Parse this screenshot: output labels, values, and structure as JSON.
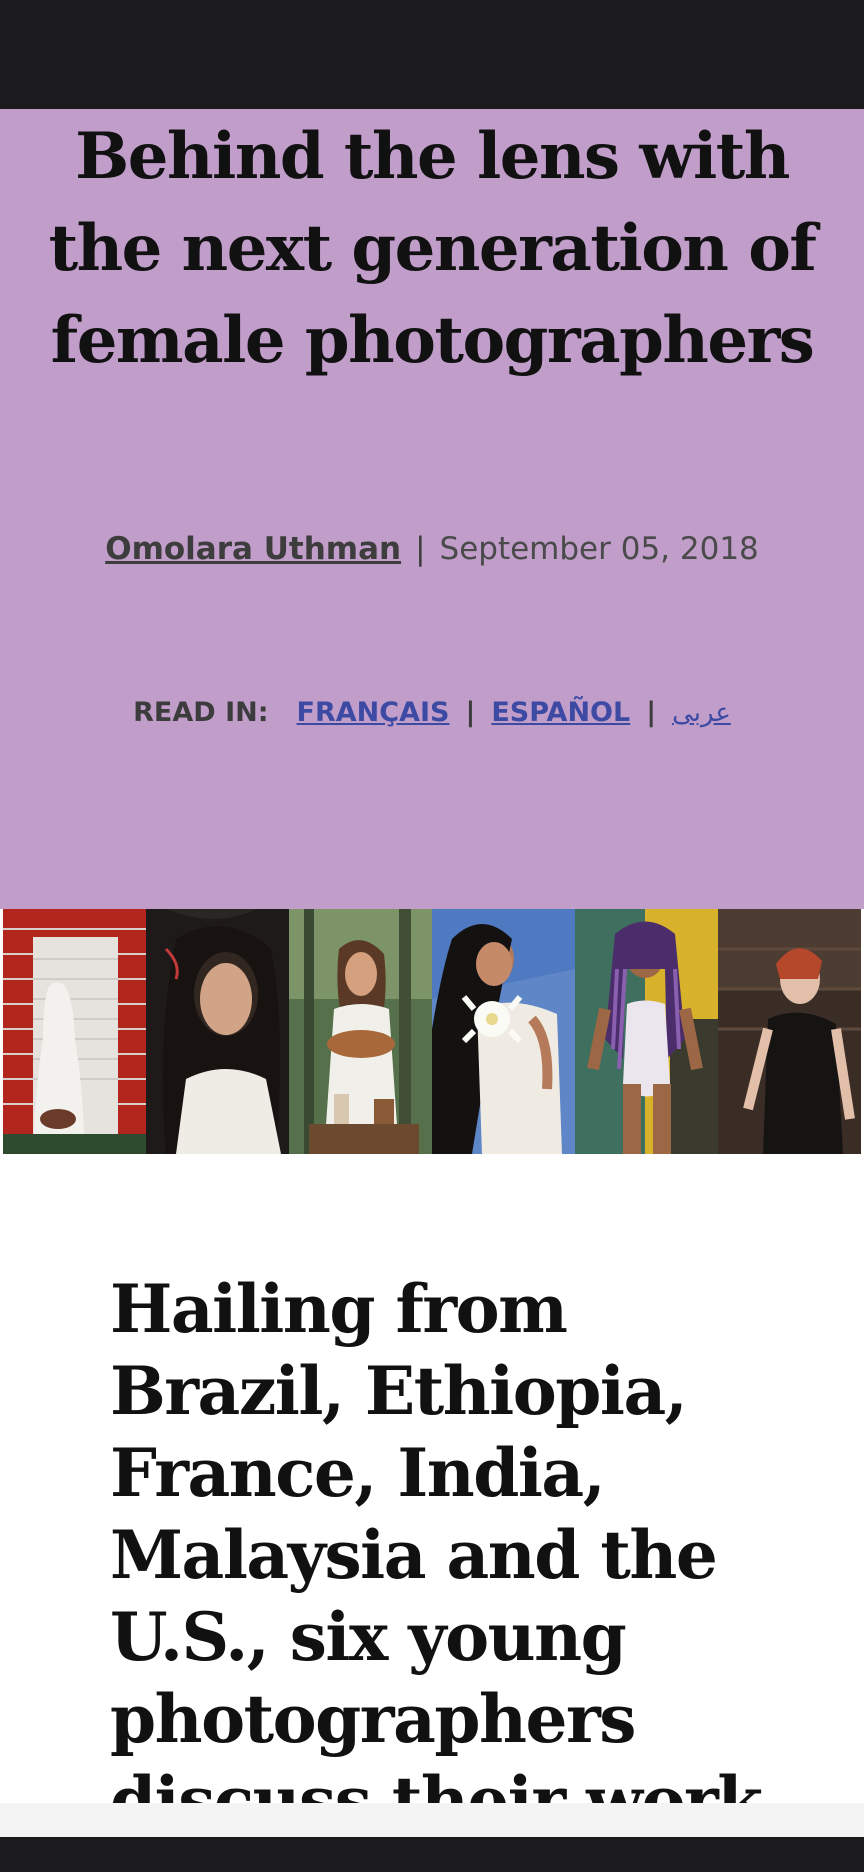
{
  "article": {
    "headline": "Behind the lens with the next generation of female photographers",
    "author": "Omolara Uthman",
    "byline_separator": "|",
    "date": "September 05, 2018"
  },
  "read_in": {
    "label": "READ IN:",
    "separator": "|",
    "languages": [
      "FRANÇAIS",
      "ESPAÑOL",
      "عربى"
    ]
  },
  "photo_strip": {
    "photos": [
      "photo-red-wall-white-robe",
      "photo-woman-eyes-closed",
      "photo-woman-holding-bowl",
      "photo-woman-with-flower",
      "photo-woman-braids-bodysuit",
      "photo-woman-red-hair"
    ]
  },
  "lede": "Hailing from Brazil, Ethiopia, France, India, Malaysia and the U.S., six young photographers discuss their work",
  "colors": {
    "hero_background": "#c19dca",
    "link": "#3d4aa3",
    "system_bars": "#1b1b1d"
  }
}
